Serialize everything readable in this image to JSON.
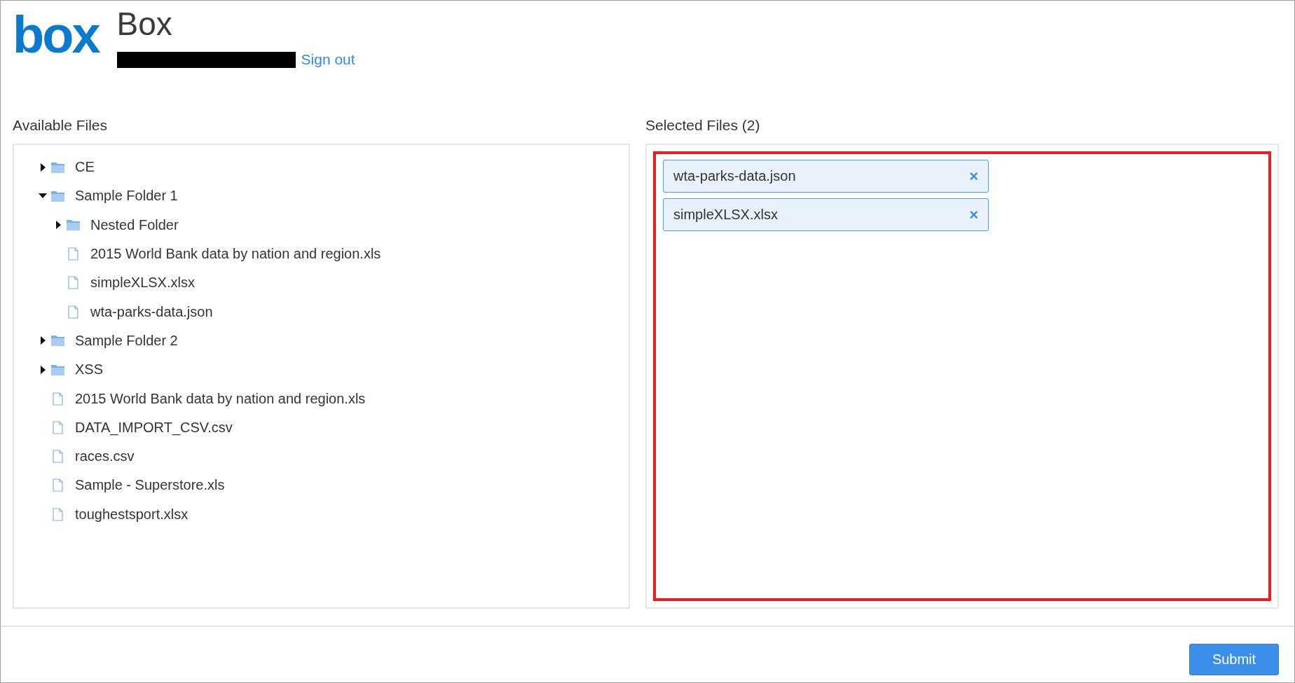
{
  "header": {
    "logo": "box",
    "title": "Box",
    "redacted": true,
    "sign_out": "Sign out"
  },
  "available": {
    "heading": "Available Files",
    "tree": [
      {
        "kind": "folder",
        "name": "CE",
        "expanded": false
      },
      {
        "kind": "folder",
        "name": "Sample Folder 1",
        "expanded": true,
        "children": [
          {
            "kind": "folder",
            "name": "Nested Folder",
            "expanded": false
          },
          {
            "kind": "file",
            "name": "2015 World Bank data by nation and region.xls"
          },
          {
            "kind": "file",
            "name": "simpleXLSX.xlsx"
          },
          {
            "kind": "file",
            "name": "wta-parks-data.json"
          }
        ]
      },
      {
        "kind": "folder",
        "name": "Sample Folder 2",
        "expanded": false
      },
      {
        "kind": "folder",
        "name": "XSS",
        "expanded": false
      },
      {
        "kind": "file",
        "name": "2015 World Bank data by nation and region.xls"
      },
      {
        "kind": "file",
        "name": "DATA_IMPORT_CSV.csv"
      },
      {
        "kind": "file",
        "name": "races.csv"
      },
      {
        "kind": "file",
        "name": "Sample - Superstore.xls"
      },
      {
        "kind": "file",
        "name": "toughestsport.xlsx"
      }
    ]
  },
  "selected": {
    "heading": "Selected Files (2)",
    "highlighted": true,
    "files": [
      {
        "name": "wta-parks-data.json",
        "remove": "×"
      },
      {
        "name": "simpleXLSX.xlsx",
        "remove": "×"
      }
    ]
  },
  "footer": {
    "submit": "Submit"
  }
}
